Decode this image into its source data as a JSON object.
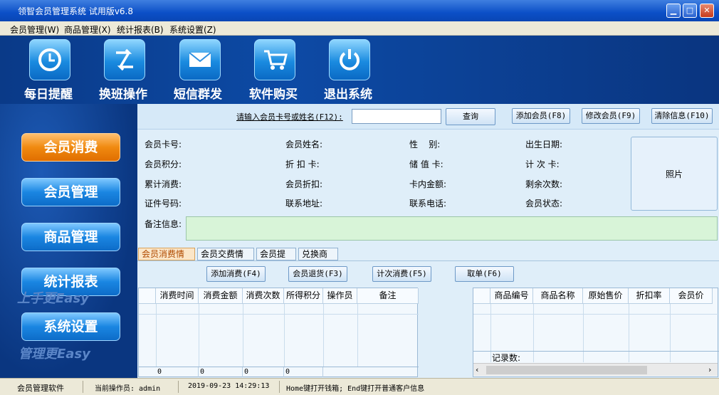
{
  "window": {
    "title": "领智会员管理系统 试用版v6.8"
  },
  "menu": [
    "会员管理(W)",
    "商品管理(X)",
    "统计报表(B)",
    "系统设置(Z)"
  ],
  "toolbar": [
    {
      "label": "每日提醒",
      "icon": "clock-icon"
    },
    {
      "label": "换班操作",
      "icon": "swap-icon"
    },
    {
      "label": "短信群发",
      "icon": "envelope-icon"
    },
    {
      "label": "软件购买",
      "icon": "cart-icon"
    },
    {
      "label": "退出系统",
      "icon": "power-icon"
    }
  ],
  "nav": [
    {
      "label": "会员消费",
      "active": true
    },
    {
      "label": "会员管理",
      "active": false
    },
    {
      "label": "商品管理",
      "active": false
    },
    {
      "label": "统计报表",
      "active": false
    },
    {
      "label": "系统设置",
      "active": false
    }
  ],
  "slogan": {
    "line1": "上手更Easy",
    "line2": "管理更Easy"
  },
  "search": {
    "label": "请输入会员卡号或姓名(F12):",
    "value": "",
    "query": "查询",
    "add": "添加会员(F8)",
    "edit": "修改会员(F9)",
    "clear": "清除信息(F10)"
  },
  "fields": {
    "card_no": "会员卡号:",
    "name": "会员姓名:",
    "gender": "性    别:",
    "birthday": "出生日期:",
    "points": "会员积分:",
    "discount_card": "折 扣 卡:",
    "stored_card": "储 值 卡:",
    "count_card": "计 次 卡:",
    "total": "累计消费:",
    "member_discount": "会员折扣:",
    "card_balance": "卡内金额:",
    "remaining": "剩余次数:",
    "id_no": "证件号码:",
    "address": "联系地址:",
    "phone": "联系电话:",
    "status": "会员状态:",
    "remark": "备注信息:",
    "photo": "照片"
  },
  "tabs": [
    "会员消费情况",
    "会员交费情况",
    "会员提醒",
    "兑换商品"
  ],
  "actions": {
    "add_consume": "添加消费(F4)",
    "return": "会员退货(F3)",
    "count_consume": "计次消费(F5)",
    "cancel": "取单(F6)"
  },
  "left_table": {
    "columns": [
      "消费时间",
      "消费金额",
      "消费次数",
      "所得积分",
      "操作员",
      "备注"
    ],
    "totals": [
      "0",
      "0",
      "0",
      "0"
    ]
  },
  "right_table": {
    "columns": [
      "商品编号",
      "商品名称",
      "原始售价",
      "折扣率",
      "会员价"
    ],
    "records_label": "记录数:"
  },
  "status": {
    "app": "会员管理软件",
    "operator": "当前操作员: admin",
    "datetime": "2019-09-23 14:29:13",
    "hint": "Home键打开钱箱; End键打开普通客户信息"
  },
  "colors": {
    "accent": "#0a46b4",
    "active_nav": "#f08a10",
    "panel": "#dfeef9"
  }
}
